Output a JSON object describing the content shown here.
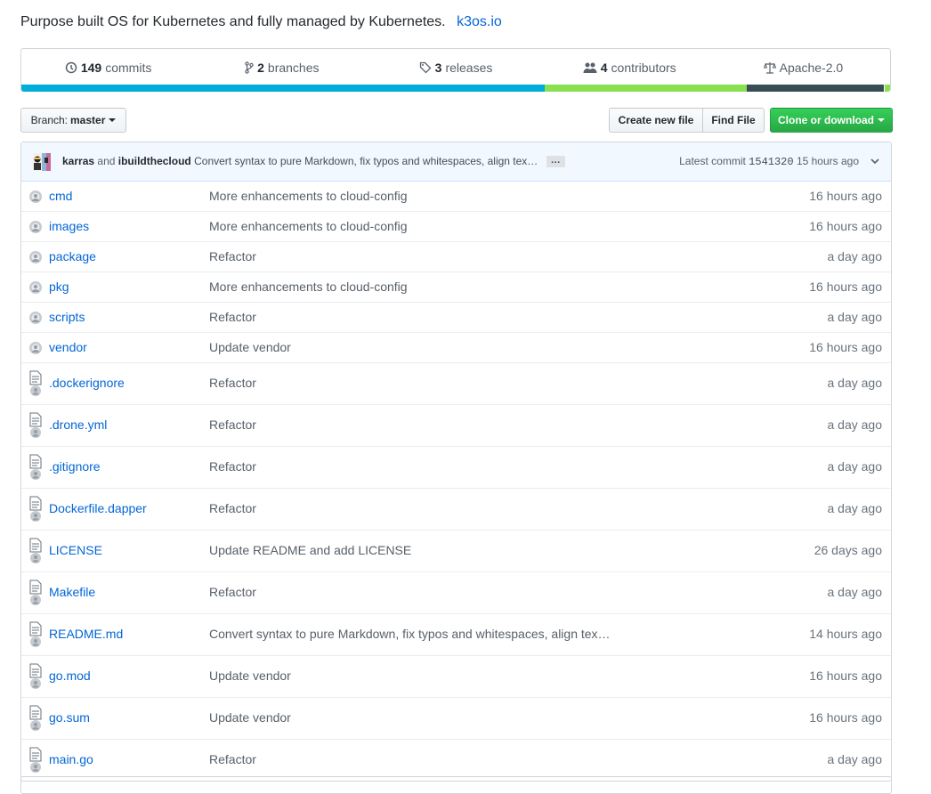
{
  "repo": {
    "description": "Purpose built OS for Kubernetes and fully managed by Kubernetes.",
    "website": "k3os.io"
  },
  "stats": [
    {
      "icon": "history-icon",
      "count": "149",
      "label": "commits"
    },
    {
      "icon": "branch-icon",
      "count": "2",
      "label": "branches"
    },
    {
      "icon": "tag-icon",
      "count": "3",
      "label": "releases"
    },
    {
      "icon": "people-icon",
      "count": "4",
      "label": "contributors"
    },
    {
      "icon": "law-icon",
      "count": "",
      "label": "Apache-2.0"
    }
  ],
  "languages": [
    {
      "color": "#00add8",
      "percent": 60.3
    },
    {
      "color": "#89e051",
      "percent": 23.3
    },
    {
      "color": "#384d54",
      "percent": 15.8
    },
    {
      "color": "#89e051",
      "percent": 0.6
    }
  ],
  "toolbar": {
    "branch_prefix": "Branch:",
    "branch_name": "master",
    "create_label": "Create new file",
    "find_label": "Find File",
    "clone_label": "Clone or download"
  },
  "commit": {
    "author1": "karras",
    "and": "and",
    "author2": "ibuildthecloud",
    "message": "Convert syntax to pure Markdown, fix typos and whitespaces, align tex…",
    "ellipsis": "…",
    "latest_label": "Latest commit",
    "sha": "1541320",
    "time": "15 hours ago"
  },
  "files": [
    {
      "type": "dir",
      "name": "cmd",
      "message": "More enhancements to cloud-config",
      "age": "16 hours ago"
    },
    {
      "type": "dir",
      "name": "images",
      "message": "More enhancements to cloud-config",
      "age": "16 hours ago"
    },
    {
      "type": "dir",
      "name": "package",
      "message": "Refactor",
      "age": "a day ago"
    },
    {
      "type": "dir",
      "name": "pkg",
      "message": "More enhancements to cloud-config",
      "age": "16 hours ago"
    },
    {
      "type": "dir",
      "name": "scripts",
      "message": "Refactor",
      "age": "a day ago"
    },
    {
      "type": "dir",
      "name": "vendor",
      "message": "Update vendor",
      "age": "16 hours ago"
    },
    {
      "type": "file",
      "name": ".dockerignore",
      "message": "Refactor",
      "age": "a day ago"
    },
    {
      "type": "file",
      "name": ".drone.yml",
      "message": "Refactor",
      "age": "a day ago"
    },
    {
      "type": "file",
      "name": ".gitignore",
      "message": "Refactor",
      "age": "a day ago"
    },
    {
      "type": "file",
      "name": "Dockerfile.dapper",
      "message": "Refactor",
      "age": "a day ago"
    },
    {
      "type": "file",
      "name": "LICENSE",
      "message": "Update README and add LICENSE",
      "age": "26 days ago"
    },
    {
      "type": "file",
      "name": "Makefile",
      "message": "Refactor",
      "age": "a day ago"
    },
    {
      "type": "file",
      "name": "README.md",
      "message": "Convert syntax to pure Markdown, fix typos and whitespaces, align tex…",
      "age": "14 hours ago"
    },
    {
      "type": "file",
      "name": "go.mod",
      "message": "Update vendor",
      "age": "16 hours ago"
    },
    {
      "type": "file",
      "name": "go.sum",
      "message": "Update vendor",
      "age": "16 hours ago"
    },
    {
      "type": "file",
      "name": "main.go",
      "message": "Refactor",
      "age": "a day ago"
    }
  ]
}
